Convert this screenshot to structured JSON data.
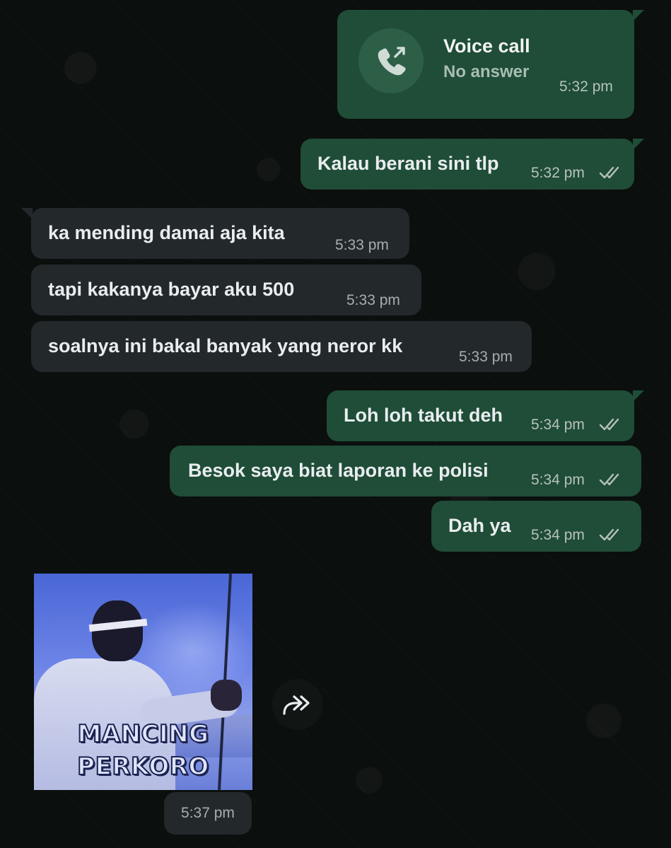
{
  "call": {
    "title": "Voice call",
    "status": "No answer",
    "time": "5:32 pm",
    "icon": "missed-outgoing-call-icon"
  },
  "messages": [
    {
      "direction": "out",
      "text": "Kalau berani sini tlp",
      "time": "5:32 pm",
      "status": "read"
    },
    {
      "direction": "in",
      "text": "ka mending damai aja kita",
      "time": "5:33 pm"
    },
    {
      "direction": "in",
      "text": "tapi kakanya bayar aku 500",
      "time": "5:33 pm"
    },
    {
      "direction": "in",
      "text": "soalnya ini bakal banyak yang neror kk",
      "time": "5:33 pm"
    },
    {
      "direction": "out",
      "text": "Loh loh takut deh",
      "time": "5:34 pm",
      "status": "read"
    },
    {
      "direction": "out",
      "text": "Besok saya biat laporan ke polisi",
      "time": "5:34 pm",
      "status": "read"
    },
    {
      "direction": "out",
      "text": "Dah ya",
      "time": "5:34 pm",
      "status": "read"
    }
  ],
  "sticker": {
    "caption_line1": "MANCING",
    "caption_line2": "PERKORO",
    "time": "5:37 pm"
  },
  "forward_icon": "forward-icon",
  "colors": {
    "background": "#0b0f0d",
    "outgoing_bubble": "#1f4d37",
    "incoming_bubble": "#23282b",
    "read_ticks": "#b7c2bc"
  }
}
